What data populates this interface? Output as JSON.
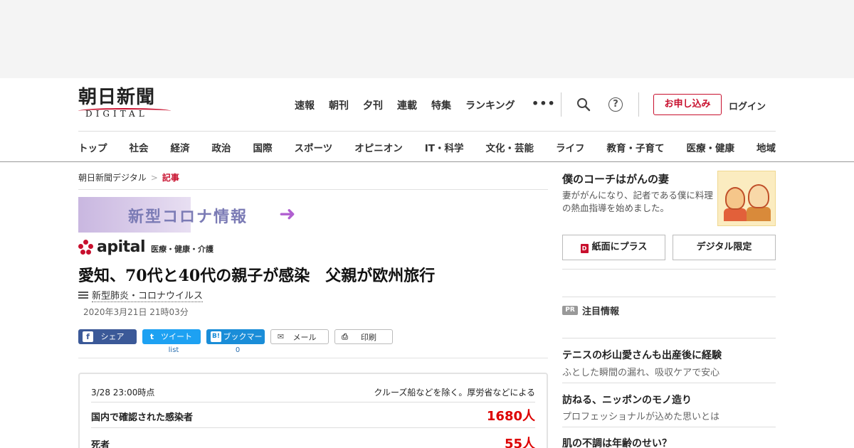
{
  "logo": {
    "kanji": "朝日新聞",
    "latin": "DIGITAL"
  },
  "utilnav": [
    "速報",
    "朝刊",
    "夕刊",
    "連載",
    "特集",
    "ランキング"
  ],
  "more": "•••",
  "help": "?",
  "subscribe": "お申し込み",
  "login": "ログイン",
  "mainnav": [
    "トップ",
    "社会",
    "経済",
    "政治",
    "国際",
    "スポーツ",
    "オピニオン",
    "IT・科学",
    "文化・芸能",
    "ライフ",
    "教育・子育て",
    "医療・健康",
    "地域"
  ],
  "breadcrumb": {
    "home": "朝日新聞デジタル",
    "sep": ">",
    "current": "記事"
  },
  "banner": {
    "text": "新型コロナ情報",
    "arrow": "➜"
  },
  "apital": {
    "name": "apital",
    "sub": "医療・健康・介護"
  },
  "article": {
    "headline": "愛知、70代と40代の親子が感染　父親が欧州旅行",
    "topic": "新型肺炎・コロナウイルス",
    "date": "2020年3月21日 21時03分"
  },
  "share": {
    "facebook": {
      "icon": "f",
      "label": "シェア"
    },
    "twitter": {
      "icon": "t",
      "label": "ツイート",
      "count": "list"
    },
    "hatena": {
      "icon": "B!",
      "label": "ブックマーク",
      "count": "0"
    },
    "mail": {
      "icon": "✉",
      "label": "メール"
    },
    "print": {
      "icon": "⎙",
      "label": "印刷"
    },
    "colors": {
      "facebook": "#3b5998",
      "twitter": "#1da1f2",
      "hatena": "#1a8dd8"
    }
  },
  "infobox": {
    "time": "3/28 23:00時点",
    "note": "クルーズ船などを除く。厚労省などによる",
    "rows": [
      {
        "label": "国内で確認された感染者",
        "value": "1680人"
      },
      {
        "label": "死者",
        "value": "55人"
      }
    ]
  },
  "sidebar": {
    "promo_title": "僕のコーチはがんの妻",
    "promo_desc": "妻ががんになり、記者である僕に料理の熱血指導を始めました。",
    "btn_paper": "紙面にプラス",
    "btn_paper_icon": "D",
    "btn_digital": "デジタル限定",
    "pr_badge": "PR",
    "pr_label": "注目情報",
    "items": [
      {
        "title": "テニスの杉山愛さんも出産後に経験",
        "desc": "ふとした瞬間の漏れ、吸収ケアで安心"
      },
      {
        "title": "訪ねる、ニッポンのモノ造り",
        "desc": "プロフェッショナルが込めた思いとは"
      },
      {
        "title": "肌の不調は年齢のせい？",
        "desc": ""
      }
    ]
  },
  "colors": {
    "brand_red": "#c8102e",
    "value_red": "#dd0000"
  }
}
